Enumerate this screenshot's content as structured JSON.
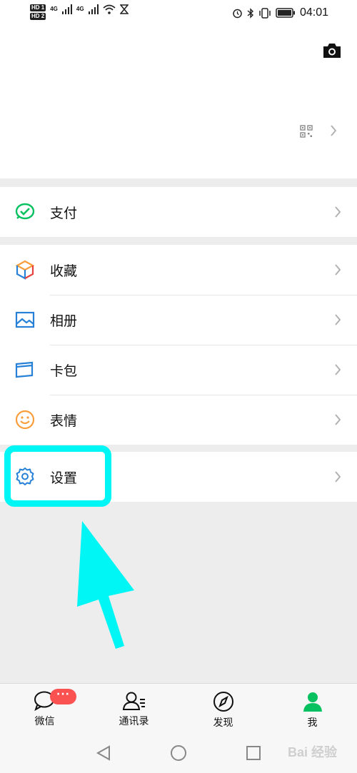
{
  "status_bar": {
    "hd_badges": [
      "HD 1",
      "HD 2"
    ],
    "network_1": "4G",
    "network_2": "4G",
    "time": "04:01"
  },
  "icons": {
    "camera": "camera-icon",
    "qr": "qr-code-icon",
    "chevron": "chevron-right-icon"
  },
  "menu": {
    "pay": {
      "label": "支付",
      "icon": "wallet-check-icon",
      "color": "#07c160"
    },
    "favorites": {
      "label": "收藏",
      "icon": "cube-icon",
      "color": "#fa9d3b"
    },
    "album": {
      "label": "相册",
      "icon": "image-icon",
      "color": "#2782d7"
    },
    "cards": {
      "label": "卡包",
      "icon": "card-icon",
      "color": "#2782d7"
    },
    "stickers": {
      "label": "表情",
      "icon": "smile-icon",
      "color": "#fa9d3b"
    },
    "settings": {
      "label": "设置",
      "icon": "gear-icon",
      "color": "#2782d7"
    }
  },
  "tabbar": {
    "chats": {
      "label": "微信",
      "badge": "···"
    },
    "contacts": {
      "label": "通讯录"
    },
    "discover": {
      "label": "发现"
    },
    "me": {
      "label": "我"
    }
  },
  "colors": {
    "highlight": "#00f5f5",
    "active_tab": "#07c160",
    "badge": "#fa5151"
  },
  "watermark": "Bai 经验"
}
